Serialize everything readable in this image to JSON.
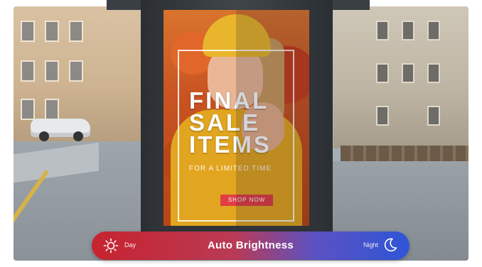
{
  "poster": {
    "headline_line1": "FINAL",
    "headline_line2": "SALE",
    "headline_line3": "ITEMS",
    "subline": "FOR A LIMITED TIME",
    "button_label": "SHOP NOW"
  },
  "brightness_bar": {
    "title": "Auto Brightness",
    "day_label": "Day",
    "night_label": "Night",
    "left_icon": "sun-icon",
    "right_icon": "moon-icon",
    "color_left": "#c7232f",
    "color_right": "#2f55d6"
  }
}
